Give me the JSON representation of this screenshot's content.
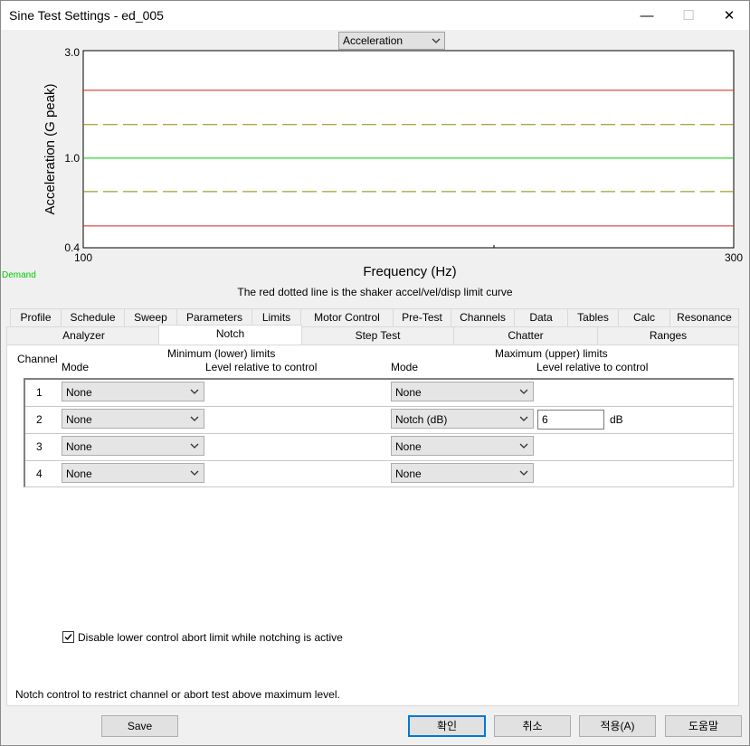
{
  "window": {
    "title": "Sine Test Settings - ed_005",
    "minimize": "—",
    "maximize": "☐",
    "close": "✕"
  },
  "plot_selector": {
    "value": "Acceleration"
  },
  "chart_data": {
    "type": "line",
    "xlabel": "Frequency (Hz)",
    "ylabel": "Acceleration (G peak)",
    "xlim": [
      100,
      300
    ],
    "ylim": [
      0.4,
      3.0
    ],
    "x_ticks": [
      "100",
      "300"
    ],
    "y_ticks": [
      "3.0",
      "1.0",
      "0.4"
    ],
    "log_y": true,
    "legend_text": "Demand",
    "series": [
      {
        "style": "solid",
        "color": "#d02020",
        "x": [
          100,
          300
        ],
        "y": [
          2.0,
          2.0
        ]
      },
      {
        "style": "dashed",
        "color": "#8a8a00",
        "x": [
          100,
          300
        ],
        "y": [
          1.41,
          1.41
        ]
      },
      {
        "name": "Demand",
        "style": "solid",
        "color": "#00cc00",
        "x": [
          100,
          300
        ],
        "y": [
          1.0,
          1.0
        ]
      },
      {
        "style": "dashed",
        "color": "#8a8a00",
        "x": [
          100,
          300
        ],
        "y": [
          0.71,
          0.71
        ]
      },
      {
        "style": "solid",
        "color": "#d02020",
        "x": [
          100,
          300
        ],
        "y": [
          0.5,
          0.5
        ]
      }
    ]
  },
  "caption": "The red dotted line is the shaker accel/vel/disp limit curve",
  "tabs_row1": [
    "Profile",
    "Schedule",
    "Sweep",
    "Parameters",
    "Limits",
    "Motor Control",
    "Pre-Test",
    "Channels",
    "Data",
    "Tables",
    "Calc",
    "Resonance"
  ],
  "tabs_row2": [
    "Analyzer",
    "Notch",
    "Step Test",
    "Chatter",
    "Ranges"
  ],
  "active_tab": "Notch",
  "notch": {
    "channel_header": "Channel",
    "min_header": "Minimum (lower) limits",
    "max_header": "Maximum (upper) limits",
    "mode_header": "Mode",
    "level_header": "Level relative to control",
    "rows": [
      {
        "channel": "1",
        "min_mode": "None",
        "max_mode": "None",
        "max_level": "",
        "unit": ""
      },
      {
        "channel": "2",
        "min_mode": "None",
        "max_mode": "Notch (dB)",
        "max_level": "6",
        "unit": "dB"
      },
      {
        "channel": "3",
        "min_mode": "None",
        "max_mode": "None",
        "max_level": "",
        "unit": ""
      },
      {
        "channel": "4",
        "min_mode": "None",
        "max_mode": "None",
        "max_level": "",
        "unit": ""
      }
    ],
    "checkbox_label": "Disable lower control abort limit while notching is active",
    "checkbox_checked": true
  },
  "status_text": "Notch control to restrict channel or abort test above maximum level.",
  "buttons": {
    "save": "Save",
    "ok": "확인",
    "cancel": "취소",
    "apply": "적용(A)",
    "help": "도움말"
  }
}
